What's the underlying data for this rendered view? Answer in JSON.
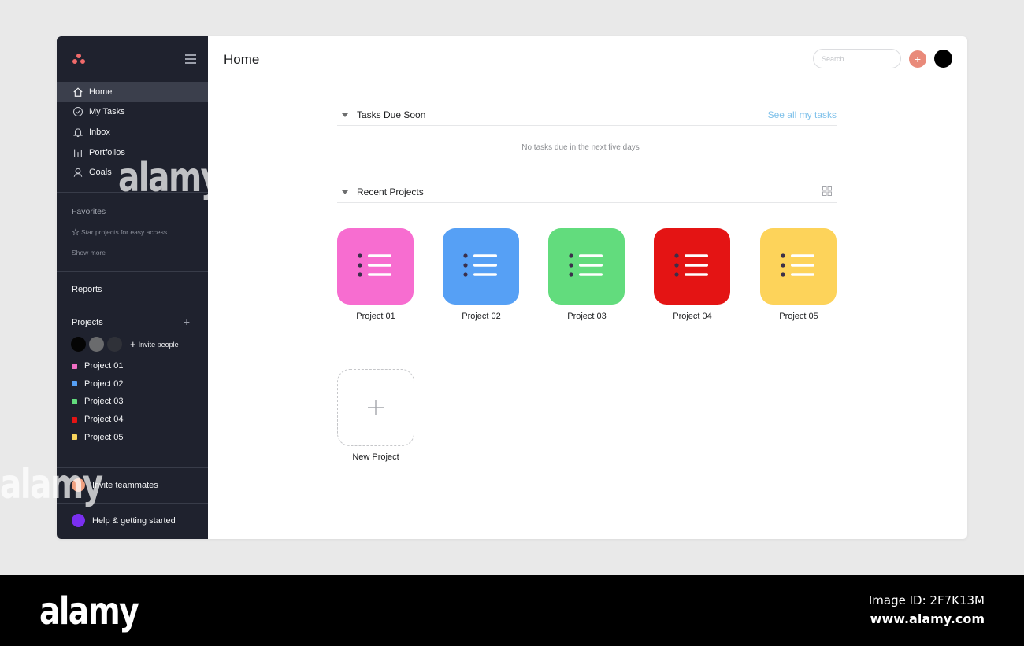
{
  "sidebar": {
    "nav": [
      {
        "label": "Home",
        "icon": "home-icon"
      },
      {
        "label": "My Tasks",
        "icon": "check-circle-icon"
      },
      {
        "label": "Inbox",
        "icon": "bell-icon"
      },
      {
        "label": "Portfolios",
        "icon": "bar-chart-icon"
      },
      {
        "label": "Goals",
        "icon": "person-icon"
      }
    ],
    "favorites_title": "Favorites",
    "favorites_hint": "Star projects for easy access",
    "show_more": "Show more",
    "reports": "Reports",
    "projects_title": "Projects",
    "invite_people": "Invite people",
    "projects": [
      {
        "label": "Project 01",
        "color": "#f06ec4"
      },
      {
        "label": "Project 02",
        "color": "#56a0f5"
      },
      {
        "label": "Project 03",
        "color": "#62dc7d"
      },
      {
        "label": "Project 04",
        "color": "#e41414"
      },
      {
        "label": "Project 05",
        "color": "#f7d45c"
      }
    ],
    "invite_teammates": "Invite teammates",
    "help": "Help & getting started"
  },
  "header": {
    "title": "Home",
    "search_placeholder": "Search..."
  },
  "tasks_section": {
    "title": "Tasks Due Soon",
    "see_all": "See all my tasks",
    "empty": "No tasks due in the next five days"
  },
  "projects_section": {
    "title": "Recent Projects",
    "new_project": "New Project"
  },
  "watermark": {
    "logo": "alamy",
    "image_id": "Image ID: 2F7K13M",
    "url": "www.alamy.com"
  }
}
